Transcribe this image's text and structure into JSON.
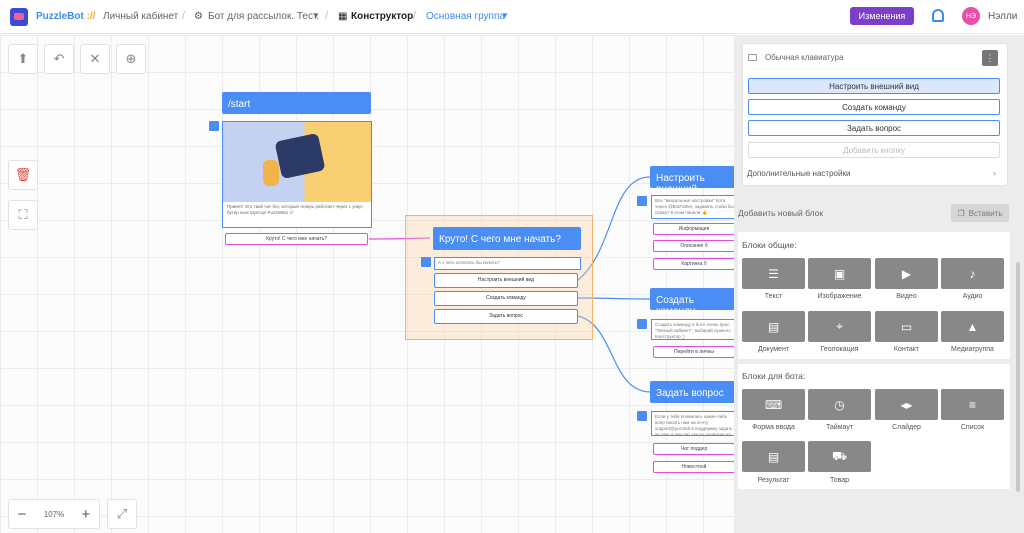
{
  "header": {
    "brand": "PuzzleBot",
    "brand_mark": "://",
    "crumb1": "Личный кабинет",
    "crumb2": "Бот для рассылок. Тест.",
    "crumb3": "Конструктор",
    "crumb4": "Основная группа",
    "changes": "Изменения",
    "avatar": "НЭ",
    "user": "Нэлли"
  },
  "canvas": {
    "zoom": "107%",
    "start_title": "/start",
    "start_text": "Привет! Это твой чат-бот, который теперь работает через с упер-бутер конструктор! PuzzleBot ://",
    "start_button": "Круто! С чего мне начать?",
    "main_title": "Круто! С чего мне начать?",
    "main_text": "А с чего хотелось бы начать?",
    "main_buttons": [
      "Настроить внешний вид",
      "Создать команду",
      "Задать вопрос"
    ],
    "n1_title": "Настроить внешний",
    "n1_text": "Все \"визуальные настройки\" бота через @BotFather, задавать стаби бы свяжут в этом панели 👍",
    "n1_buttons": [
      "Информация",
      "Описание б",
      "Картинка б"
    ],
    "n2_title": "Создать команду",
    "n2_text": "Создать команду в боте очень прос \"Личный кабинет\", выбирай нужного Конструктор :)",
    "n2_buttons": [
      "Перейти в личны"
    ],
    "n3_title": "Задать вопрос",
    "n3_text": "Если у тебя появились какие-либо вопр писать нам на почту support@puzzleb в поддержку задать их там, в учи дет так по подписке на Новостно",
    "n3_buttons": [
      "Чат поддер",
      "Новостной"
    ]
  },
  "panel": {
    "keyboard_title": "Обычная клавиатура",
    "keyboard_buttons": [
      "Настроить внешний вид",
      "Создать команду",
      "Задать вопрос"
    ],
    "add_button": "Добавить кнопку",
    "extra_settings": "Дополнительные настройки",
    "add_block": "Добавить новый блок",
    "paste": "Вставить",
    "common_title": "Блоки общие:",
    "common_blocks": [
      "Текст",
      "Изображение",
      "Видео",
      "Аудио",
      "Документ",
      "Геолокация",
      "Контакт",
      "Медиагруппа"
    ],
    "bot_title": "Блоки для бота:",
    "bot_blocks": [
      "Форма ввода",
      "Таймаут",
      "Слайдер",
      "Список",
      "Результат",
      "Товар"
    ]
  },
  "colors": {
    "accent": "#4a8ef5",
    "pink": "#e14ed6",
    "purple": "#7b3fc9",
    "tile": "#888888"
  }
}
